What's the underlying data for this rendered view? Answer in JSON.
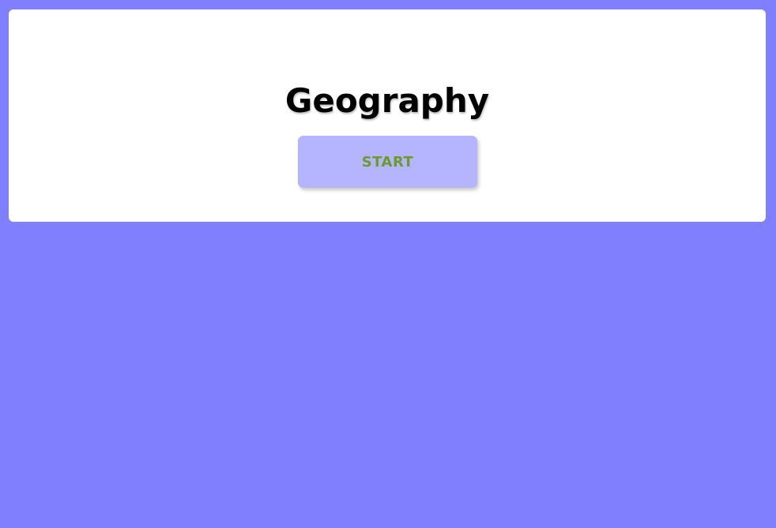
{
  "page": {
    "background_color": "#8080ff"
  },
  "card": {
    "background_color": "#ffffff",
    "title": "Geography",
    "start_label": "START",
    "button_color": "#b4b4ff",
    "button_text_color": "#6b9a2e"
  }
}
